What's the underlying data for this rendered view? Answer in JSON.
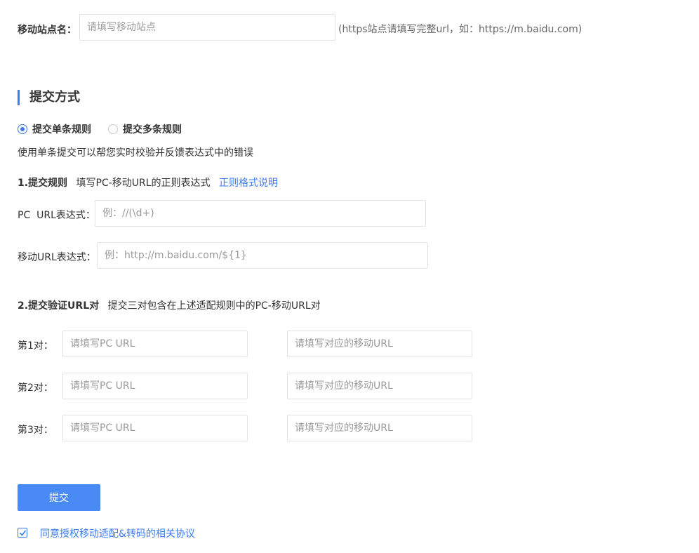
{
  "mobile_site": {
    "label": "移动站点名：",
    "placeholder": "请填写移动站点",
    "hint": "(https站点请填写完整url，如：https://m.baidu.com)"
  },
  "section": {
    "title": "提交方式"
  },
  "submit_mode": {
    "options": [
      {
        "label": "提交单条规则",
        "checked": true
      },
      {
        "label": "提交多条规则",
        "checked": false
      }
    ],
    "description": "使用单条提交可以帮您实时校验并反馈表达式中的错误"
  },
  "rules": {
    "step_title": "1.提交规则",
    "step_desc": "填写PC-移动URL的正则表达式",
    "help_link": "正则格式说明",
    "pc_label": "PC  URL表达式：",
    "pc_placeholder": "例：//(\\d+)",
    "mobile_label": "移动URL表达式：",
    "mobile_placeholder": "例：http://m.baidu.com/${1}"
  },
  "verify": {
    "step_title": "2.提交验证URL对",
    "step_desc": "提交三对包含在上述适配规则中的PC-移动URL对",
    "pairs": [
      {
        "label": "第1对：",
        "pc_placeholder": "请填写PC URL",
        "mobile_placeholder": "请填写对应的移动URL"
      },
      {
        "label": "第2对：",
        "pc_placeholder": "请填写PC URL",
        "mobile_placeholder": "请填写对应的移动URL"
      },
      {
        "label": "第3对：",
        "pc_placeholder": "请填写PC URL",
        "mobile_placeholder": "请填写对应的移动URL"
      }
    ]
  },
  "actions": {
    "submit_label": "提交",
    "agreement_label": "同意授权移动适配&转码的相关协议",
    "agreement_checked": true
  },
  "colors": {
    "accent": "#3a7bf0",
    "button": "#4a8af4"
  }
}
